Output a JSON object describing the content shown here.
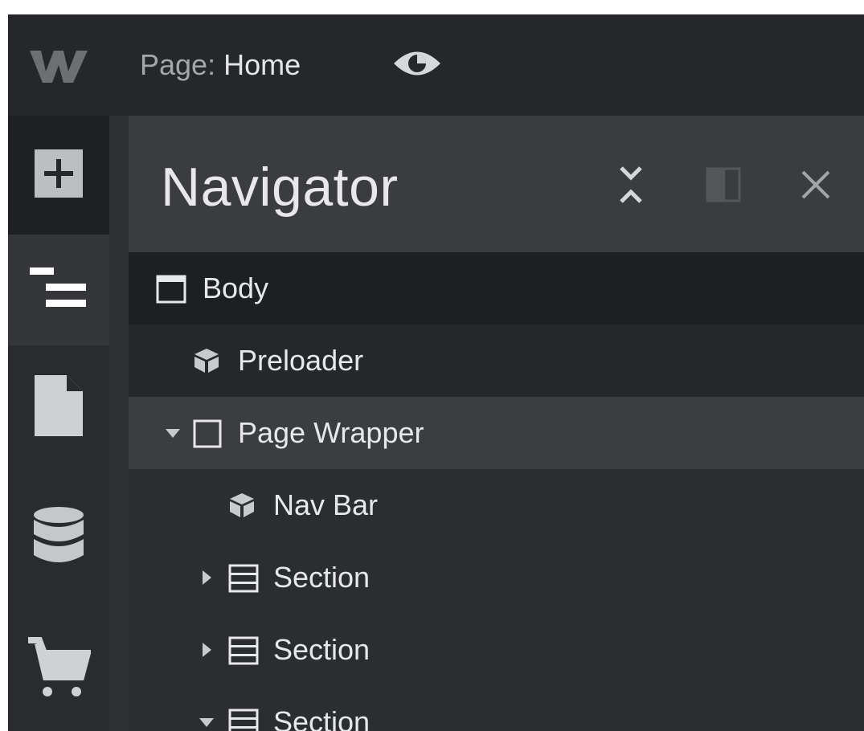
{
  "topbar": {
    "page_prefix": "Page:",
    "page_name": "Home",
    "logo_icon": "webflow-logo-icon",
    "preview_icon": "eye-icon"
  },
  "rail": {
    "items": [
      {
        "icon": "add-panel-icon",
        "active": false
      },
      {
        "icon": "navigator-icon",
        "active": true
      },
      {
        "icon": "pages-icon",
        "active": false
      },
      {
        "icon": "cms-database-icon",
        "active": false
      },
      {
        "icon": "ecommerce-cart-icon",
        "active": false
      }
    ]
  },
  "panel": {
    "title": "Navigator",
    "buttons": [
      "collapse-all-icon",
      "dock-panel-icon",
      "close-icon"
    ]
  },
  "tree": {
    "nodes": [
      {
        "label": "Body",
        "icon": "body-icon"
      },
      {
        "label": "Preloader",
        "icon": "symbol-icon"
      },
      {
        "label": "Page Wrapper",
        "icon": "div-block-icon",
        "expanded": true
      },
      {
        "label": "Nav Bar",
        "icon": "symbol-icon"
      },
      {
        "label": "Section",
        "icon": "section-icon",
        "expanded": false
      },
      {
        "label": "Section",
        "icon": "section-icon",
        "expanded": false
      },
      {
        "label": "Section",
        "icon": "section-icon",
        "expanded": true
      }
    ]
  },
  "colors": {
    "background": "#2b2c30",
    "selected_row": "#3c3d41",
    "text": "#e7e8ea"
  }
}
